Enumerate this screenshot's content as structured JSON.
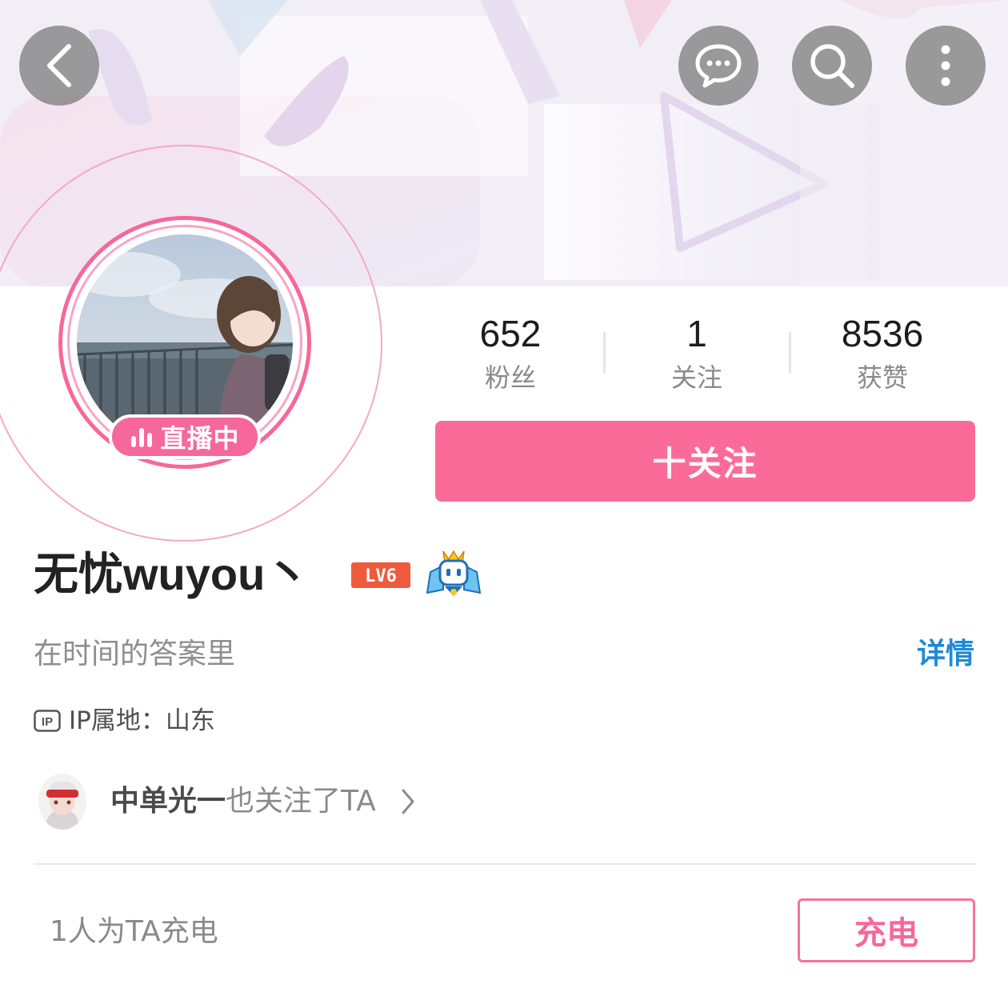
{
  "header": {
    "back_icon": "chevron-left-icon",
    "actions": [
      "chat-bubble-icon",
      "search-icon",
      "more-vertical-icon"
    ]
  },
  "profile": {
    "live_badge": "直播中",
    "name": "无忧wuyou丶",
    "level_badge": "LV6",
    "bio": "在时间的答案里",
    "detail_link": "详情",
    "ip_tag": "IP",
    "ip_location": "IP属地：山东"
  },
  "stats": [
    {
      "value": "652",
      "label": "粉丝"
    },
    {
      "value": "1",
      "label": "关注"
    },
    {
      "value": "8536",
      "label": "获赞"
    }
  ],
  "follow_button": "十关注",
  "mutual": {
    "name": "中单光一",
    "suffix": "也关注了TA"
  },
  "charge": {
    "count_text": "1人为TA充电",
    "button": "充电"
  },
  "colors": {
    "accent_pink": "#fb6b99",
    "link_blue": "#1e8ad6"
  }
}
